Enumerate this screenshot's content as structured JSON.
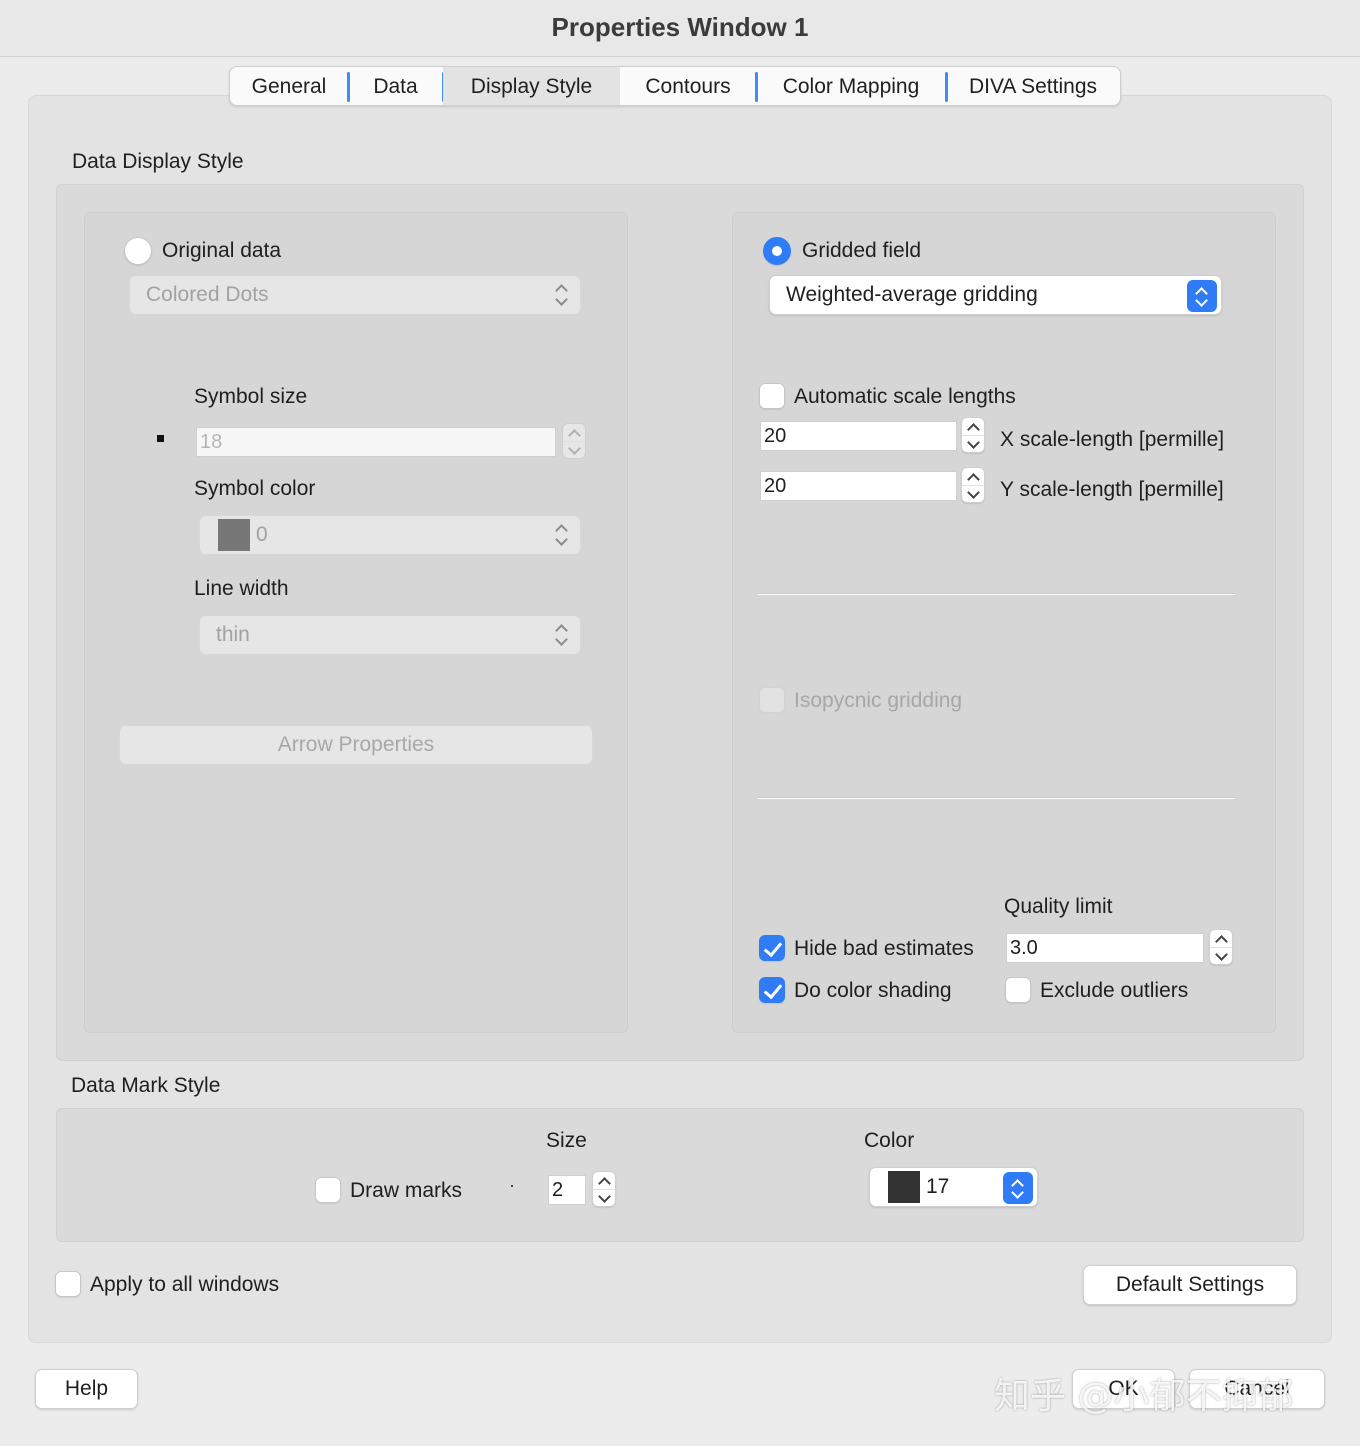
{
  "window": {
    "title": "Properties Window 1"
  },
  "tabs": [
    {
      "label": "General",
      "active": false
    },
    {
      "label": "Data",
      "active": false
    },
    {
      "label": "Display Style",
      "active": true
    },
    {
      "label": "Contours",
      "active": false
    },
    {
      "label": "Color Mapping",
      "active": false
    },
    {
      "label": "DIVA Settings",
      "active": false
    }
  ],
  "data_display_style": {
    "title": "Data Display Style",
    "original": {
      "radio_label": "Original data",
      "selected": false,
      "style_popup": "Colored Dots",
      "symbol_size_label": "Symbol size",
      "symbol_size_value": "18",
      "symbol_color_label": "Symbol color",
      "symbol_color_value": "0",
      "symbol_color_swatch": "#777777",
      "line_width_label": "Line width",
      "line_width_value": "thin",
      "arrow_button": "Arrow Properties"
    },
    "gridded": {
      "radio_label": "Gridded field",
      "selected": true,
      "method_popup": "Weighted-average gridding",
      "auto_scale_label": "Automatic scale lengths",
      "auto_scale_checked": false,
      "x_scale_value": "20",
      "x_scale_label": "X scale-length [permille]",
      "y_scale_value": "20",
      "y_scale_label": "Y scale-length [permille]",
      "isopycnic_label": "Isopycnic gridding",
      "quality_limit_label": "Quality limit",
      "quality_limit_value": "3.0",
      "hide_bad_label": "Hide bad estimates",
      "hide_bad_checked": true,
      "color_shading_label": "Do color shading",
      "color_shading_checked": true,
      "exclude_outliers_label": "Exclude outliers",
      "exclude_outliers_checked": false
    }
  },
  "data_mark_style": {
    "title": "Data Mark Style",
    "draw_marks_label": "Draw marks",
    "draw_marks_checked": false,
    "size_label": "Size",
    "size_value": "2",
    "color_label": "Color",
    "color_value": "17",
    "color_swatch": "#333333"
  },
  "footer": {
    "apply_all_label": "Apply to all windows",
    "default_settings": "Default Settings",
    "help": "Help",
    "ok": "OK",
    "cancel": "Cancel",
    "watermark": "知乎 @小郁不抑郁"
  },
  "colors": {
    "accent": "#2f7cf6",
    "panel": "#e3e3e3"
  }
}
